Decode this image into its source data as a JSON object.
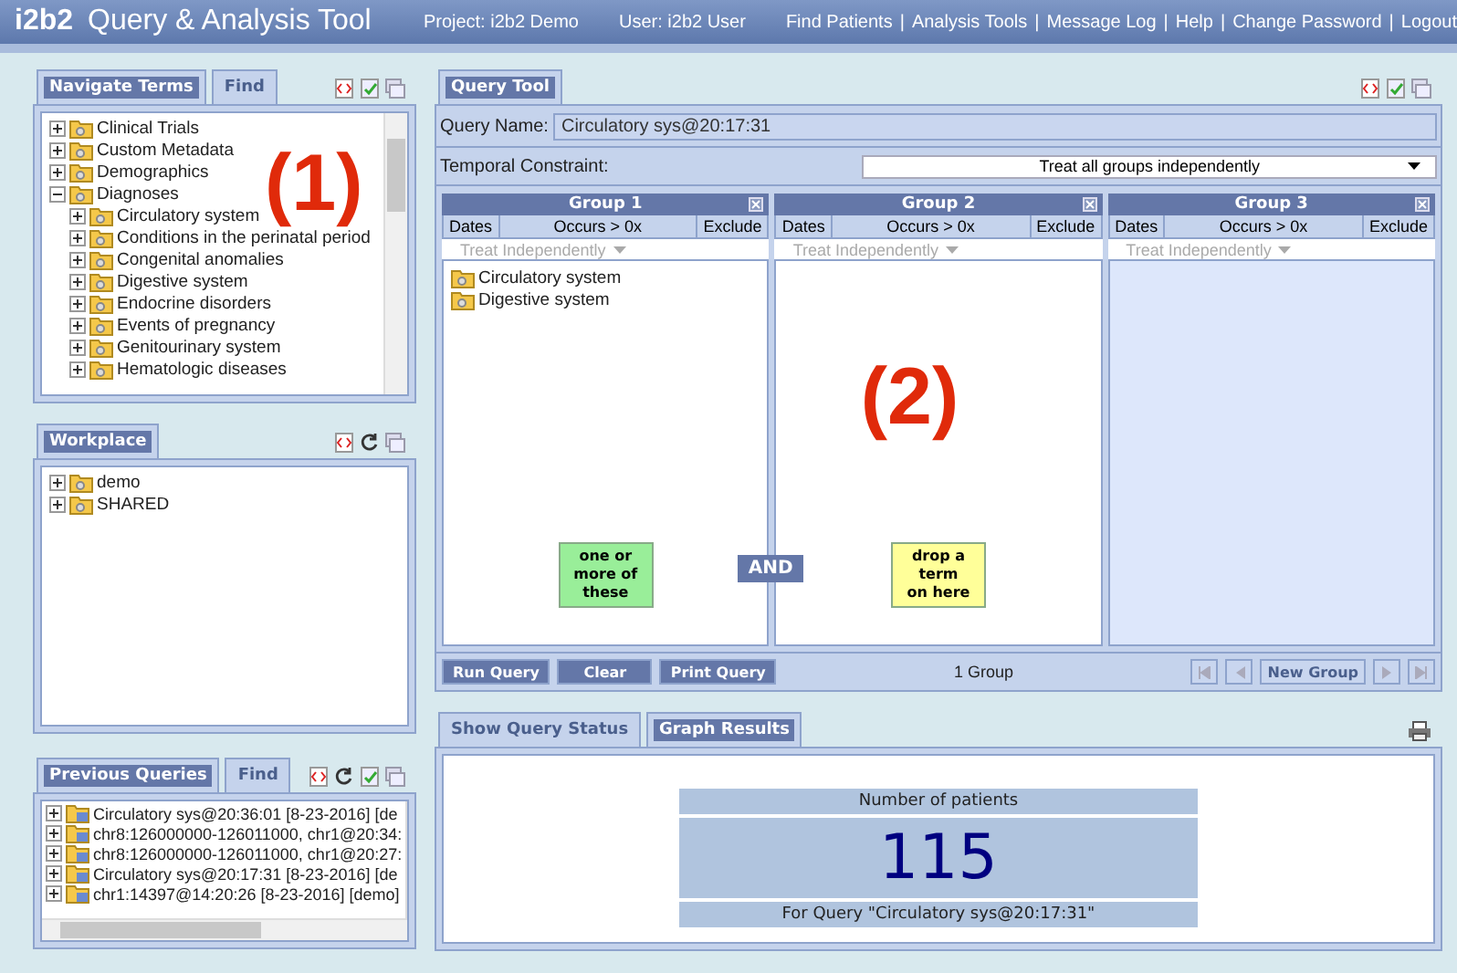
{
  "header": {
    "logo": "i2b2",
    "title": "Query & Analysis Tool",
    "project": "Project: i2b2 Demo",
    "user": "User: i2b2 User",
    "separator": "|",
    "links": [
      "Find Patients",
      "Analysis Tools",
      "Message Log",
      "Help",
      "Change Password",
      "Logout"
    ]
  },
  "navigate": {
    "tabs": [
      {
        "label": "Navigate Terms",
        "selected": true
      },
      {
        "label": "Find",
        "selected": false
      }
    ],
    "annotation": "(1)",
    "tree": [
      {
        "label": "Clinical Trials",
        "expanded": false
      },
      {
        "label": "Custom Metadata",
        "expanded": false
      },
      {
        "label": "Demographics",
        "expanded": false
      },
      {
        "label": "Diagnoses",
        "expanded": true,
        "children": [
          {
            "label": "Circulatory system",
            "expanded": false
          },
          {
            "label": "Conditions in the perinatal period",
            "expanded": false
          },
          {
            "label": "Congenital anomalies",
            "expanded": false
          },
          {
            "label": "Digestive system",
            "expanded": false
          },
          {
            "label": "Endocrine disorders",
            "expanded": false
          },
          {
            "label": "Events of pregnancy",
            "expanded": false
          },
          {
            "label": "Genitourinary system",
            "expanded": false
          },
          {
            "label": "Hematologic diseases",
            "expanded": false
          }
        ]
      }
    ]
  },
  "workplace": {
    "tabs": [
      {
        "label": "Workplace",
        "selected": true
      }
    ],
    "items": [
      {
        "label": "demo",
        "expanded": false
      },
      {
        "label": "SHARED",
        "expanded": false
      }
    ]
  },
  "previous_queries": {
    "tabs": [
      {
        "label": "Previous Queries",
        "selected": true
      },
      {
        "label": "Find",
        "selected": false
      }
    ],
    "items": [
      {
        "label": "Circulatory sys@20:36:01 [8-23-2016] [de",
        "expanded": false
      },
      {
        "label": "chr8:126000000-126011000, chr1@20:34:",
        "expanded": false
      },
      {
        "label": "chr8:126000000-126011000, chr1@20:27:",
        "expanded": false
      },
      {
        "label": "Circulatory sys@20:17:31 [8-23-2016] [de",
        "expanded": false
      },
      {
        "label": "chr1:14397@14:20:26 [8-23-2016] [demo]",
        "expanded": false
      }
    ]
  },
  "query_tool": {
    "tabs": [
      {
        "label": "Query Tool",
        "selected": true
      }
    ],
    "query_name": {
      "label": "Query Name:",
      "value": "Circulatory sys@20:17:31"
    },
    "temporal_constraint": {
      "label": "Temporal Constraint:",
      "value": "Treat all groups independently"
    },
    "annotation": "(2)",
    "connector": "AND",
    "groups": [
      {
        "title": "Group 1",
        "dates": "Dates",
        "occurs": "Occurs > 0x",
        "exclude": "Exclude",
        "timing": "Treat Independently",
        "inactive": false,
        "items": [
          "Circulatory system",
          "Digestive system"
        ],
        "hint": {
          "text": "one or\nmore of\nthese",
          "color": "#99ee99"
        }
      },
      {
        "title": "Group 2",
        "dates": "Dates",
        "occurs": "Occurs > 0x",
        "exclude": "Exclude",
        "timing": "Treat Independently",
        "inactive": false,
        "hint": {
          "text": "drop a\nterm\non here",
          "color": "#ffff99"
        }
      },
      {
        "title": "Group 3",
        "dates": "Dates",
        "occurs": "Occurs > 0x",
        "exclude": "Exclude",
        "timing": "Treat Independently",
        "inactive": true
      }
    ],
    "buttons": [
      "Run Query",
      "Clear",
      "Print Query"
    ],
    "group_count": "1 Group",
    "new_group": "New Group"
  },
  "results": {
    "tabs": [
      {
        "label": "Show Query Status",
        "selected": false
      },
      {
        "label": "Graph Results",
        "selected": true
      }
    ],
    "heading": "Number of patients",
    "value": "115",
    "caption": "For Query \"Circulatory sys@20:17:31\""
  }
}
